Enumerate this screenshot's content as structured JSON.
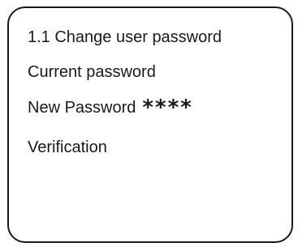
{
  "menu": {
    "title": "1.1 Change user password",
    "current_password_label": "Current password",
    "new_password_label": "New Password",
    "new_password_value": "****",
    "verification_label": "Verification"
  }
}
